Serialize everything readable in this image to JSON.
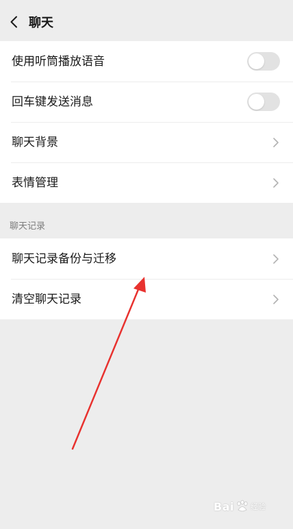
{
  "header": {
    "title": "聊天"
  },
  "settings_group_1": {
    "items": [
      {
        "label": "使用听筒播放语音",
        "control": "toggle",
        "on": false
      },
      {
        "label": "回车键发送消息",
        "control": "toggle",
        "on": false
      },
      {
        "label": "聊天背景",
        "control": "chevron-right-icon"
      },
      {
        "label": "表情管理",
        "control": "chevron-right-icon"
      }
    ]
  },
  "chat_history_section": {
    "label": "聊天记录",
    "items": [
      {
        "label": "聊天记录备份与迁移",
        "control": "chevron-right-icon"
      },
      {
        "label": "清空聊天记录",
        "control": "chevron-right-icon"
      }
    ]
  },
  "annotation": {
    "color": "#e8322f"
  },
  "watermark": {
    "text": "Bai",
    "sub": "经验"
  }
}
